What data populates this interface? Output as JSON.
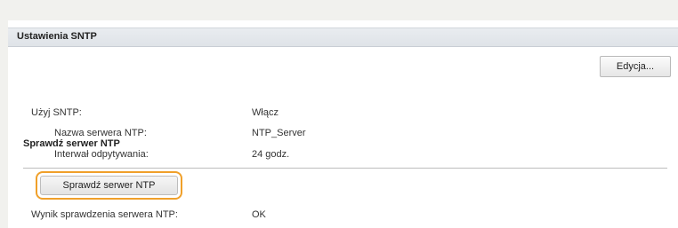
{
  "section": {
    "title": "Ustawienia SNTP",
    "edit_button": "Edycja..."
  },
  "settings": [
    {
      "label": "Użyj SNTP:",
      "value": "Włącz"
    },
    {
      "label": "Nazwa serwera NTP:",
      "value": "NTP_Server"
    },
    {
      "label": "Interwał odpytywania:",
      "value": "24 godz."
    }
  ],
  "check_section": {
    "title": "Sprawdź serwer NTP",
    "button": "Sprawdź serwer NTP",
    "result_label": "Wynik sprawdzenia serwera NTP:",
    "result_value": "OK"
  },
  "colors": {
    "highlight": "#f0a02a"
  }
}
